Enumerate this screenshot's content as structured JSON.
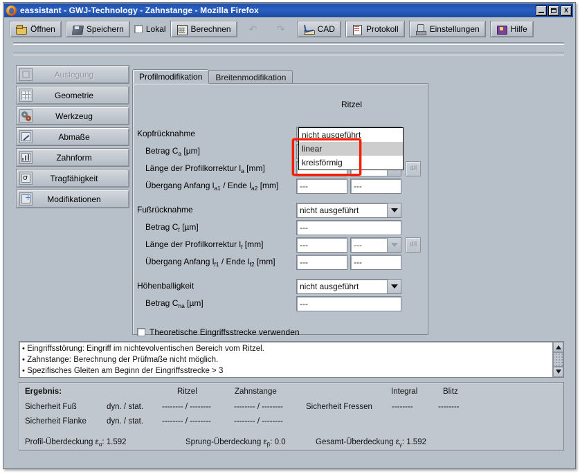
{
  "window": {
    "title": "eassistant - GWJ-Technology - Zahnstange - Mozilla Firefox",
    "app_icon": "firefox-icon",
    "controls": {
      "minimize": "_",
      "maximize": "□",
      "close": "X"
    }
  },
  "toolbar": {
    "buttons": [
      {
        "label": "Öffnen",
        "icon": "open-folder-icon",
        "enabled": true
      },
      {
        "label": "Speichern",
        "icon": "save-disk-icon",
        "enabled": true
      },
      {
        "label": "Lokal",
        "icon": "checkbox-icon",
        "enabled": true,
        "checked": false,
        "type": "checkbox"
      },
      {
        "label": "Berechnen",
        "icon": "calculator-icon",
        "enabled": true
      },
      {
        "label": "",
        "icon": "undo-icon",
        "enabled": false
      },
      {
        "label": "",
        "icon": "redo-icon",
        "enabled": false
      },
      {
        "label": "CAD",
        "icon": "cad-ruler-icon",
        "enabled": true
      },
      {
        "label": "Protokoll",
        "icon": "protocol-document-icon",
        "enabled": true
      },
      {
        "label": "Einstellungen",
        "icon": "settings-icon",
        "enabled": true
      },
      {
        "label": "Hilfe",
        "icon": "help-book-icon",
        "enabled": true
      }
    ]
  },
  "sidebar": {
    "items": [
      {
        "label": "Auslegung",
        "icon": "auslegung-icon",
        "enabled": false,
        "active": false
      },
      {
        "label": "Geometrie",
        "icon": "grid-icon",
        "enabled": true,
        "active": false
      },
      {
        "label": "Werkzeug",
        "icon": "gears-icon",
        "enabled": true,
        "active": false
      },
      {
        "label": "Abmaße",
        "icon": "dimensions-icon",
        "enabled": true,
        "active": false
      },
      {
        "label": "Zahnform",
        "icon": "tooth-profile-icon",
        "enabled": true,
        "active": false
      },
      {
        "label": "Tragfähigkeit",
        "icon": "sigma-strength-icon",
        "enabled": true,
        "active": false
      },
      {
        "label": "Modifikationen",
        "icon": "modifications-icon",
        "enabled": true,
        "active": true
      }
    ]
  },
  "tabs": [
    {
      "label": "Profilmodifikation",
      "active": true
    },
    {
      "label": "Breitenmodifikation",
      "active": false
    }
  ],
  "form": {
    "column_header": "Ritzel",
    "rows": [
      {
        "name": "kopfruecknahme",
        "label": "Kopfrücknahme",
        "type": "combo",
        "value": "nicht ausgeführt",
        "indent": false
      },
      {
        "name": "betrag-ca",
        "label": "Betrag C",
        "sub": "a",
        "unit": " [µm]",
        "type": "text",
        "value": "---",
        "indent": true
      },
      {
        "name": "laenge-profilkorrektur-la",
        "label": "Länge der Profilkorrektur l",
        "sub": "a",
        "unit": " [mm]",
        "type": "text+combo",
        "value": "---",
        "value2": "---",
        "indent": true,
        "has_dl": true
      },
      {
        "name": "uebergang-la1-la2",
        "label": "Übergang Anfang l",
        "sub": "a1",
        "mid": " / Ende l",
        "sub2": "a2",
        "unit": " [mm]",
        "type": "text+text",
        "value": "---",
        "value2": "---",
        "indent": true
      },
      {
        "name": "fussruecknahme",
        "label": "Fußrücknahme",
        "type": "combo",
        "value": "nicht ausgeführt",
        "indent": false
      },
      {
        "name": "betrag-cf",
        "label": "Betrag C",
        "sub": "f",
        "unit": " [µm]",
        "type": "text",
        "value": "---",
        "indent": true
      },
      {
        "name": "laenge-profilkorrektur-lf",
        "label": "Länge der Profilkorrektur l",
        "sub": "f",
        "unit": " [mm]",
        "type": "text+combo",
        "value": "---",
        "value2": "---",
        "indent": true,
        "has_dl": true
      },
      {
        "name": "uebergang-lf1-lf2",
        "label": "Übergang Anfang l",
        "sub": "f1",
        "mid": " / Ende l",
        "sub2": "f2",
        "unit": " [mm]",
        "type": "text+text",
        "value": "---",
        "value2": "---",
        "indent": true
      },
      {
        "name": "hoehenballigkeit",
        "label": "Höhenballigkeit",
        "type": "combo",
        "value": "nicht ausgeführt",
        "indent": false
      },
      {
        "name": "betrag-cha",
        "label": "Betrag C",
        "sub": "ha",
        "unit": " [µm]",
        "type": "text",
        "value": "---",
        "indent": true
      }
    ],
    "dl_button_label": "d/l",
    "checkbox": {
      "label": "Theoretische Eingriffsstrecke verwenden",
      "checked": false
    }
  },
  "dropdown": {
    "open": true,
    "options": [
      {
        "label": "nicht ausgeführt",
        "selected": false
      },
      {
        "label": "linear",
        "selected": true
      },
      {
        "label": "kreisförmig",
        "selected": false
      }
    ],
    "annotation_color": "#fb1c00"
  },
  "messages": [
    "Eingriffsstörung: Eingriff im nichtevolventischen Bereich vom Ritzel.",
    "Zahnstange: Berechnung der Prüfmaße nicht möglich.",
    "Spezifisches Gleiten am Beginn der Eingriffsstrecke > 3"
  ],
  "result": {
    "title": "Ergebnis:",
    "col_ritzel": "Ritzel",
    "col_zahnstange": "Zahnstange",
    "col_integral": "Integral",
    "col_blitz": "Blitz",
    "rows": [
      {
        "label": "Sicherheit Fuß",
        "mode": "dyn. / stat.",
        "ritzel": "-------- / --------",
        "zahnstange": "-------- / --------"
      },
      {
        "label": "Sicherheit Flanke",
        "mode": "dyn. / stat.",
        "ritzel": "-------- / --------",
        "zahnstange": "-------- / --------"
      }
    ],
    "fressen_label": "Sicherheit Fressen",
    "fressen_integral": "--------",
    "fressen_blitz": "--------",
    "overlap": [
      {
        "label": "Profil-Überdeckung ε",
        "sub": "α",
        "value": ": 1.592"
      },
      {
        "label": "Sprung-Überdeckung ε",
        "sub": "β",
        "value": ": 0.0"
      },
      {
        "label": "Gesamt-Überdeckung ε",
        "sub": "γ",
        "value": ": 1.592"
      }
    ]
  }
}
